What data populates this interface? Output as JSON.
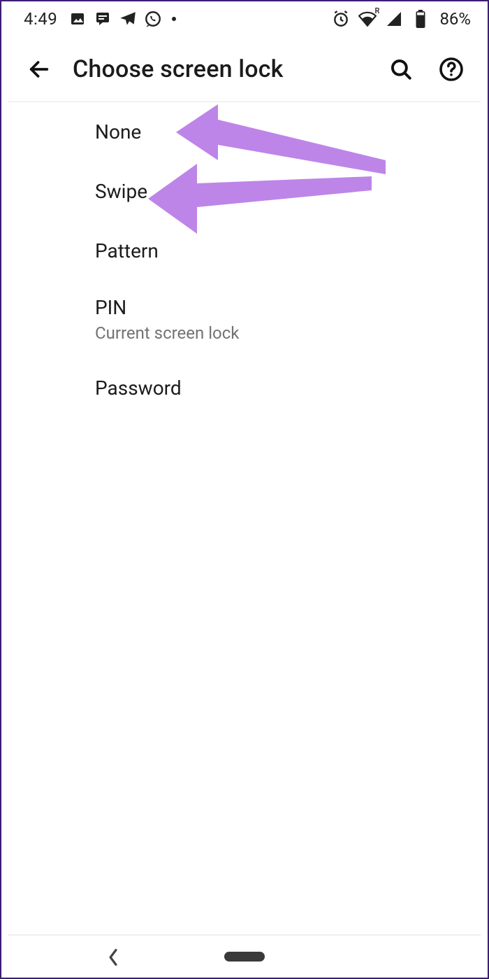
{
  "statusbar": {
    "time": "4:49",
    "battery_pct": "86%",
    "wifi_badge": "R"
  },
  "appbar": {
    "title": "Choose screen lock"
  },
  "list": {
    "items": [
      {
        "title": "None"
      },
      {
        "title": "Swipe"
      },
      {
        "title": "Pattern"
      },
      {
        "title": "PIN",
        "subtitle": "Current screen lock"
      },
      {
        "title": "Password"
      }
    ]
  },
  "annotation": {
    "color": "#be85e8"
  }
}
